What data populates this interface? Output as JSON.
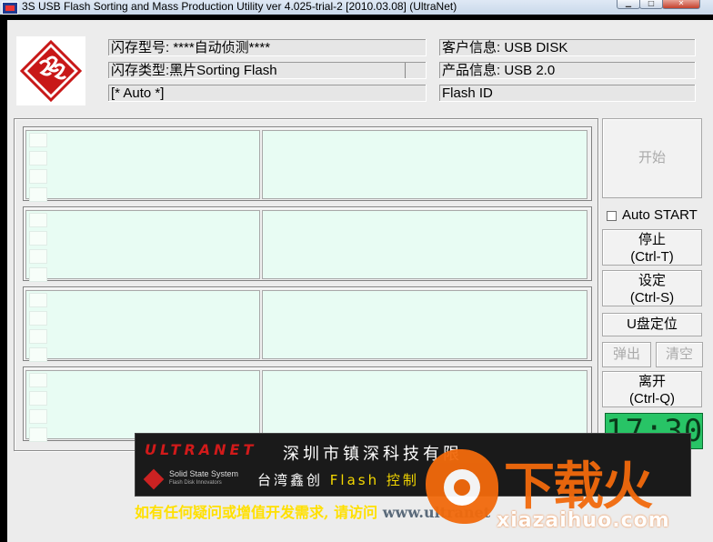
{
  "window": {
    "title": "3S USB Flash Sorting and Mass Production Utility ver 4.025-trial-2 [2010.03.08] (UltraNet)"
  },
  "info": {
    "flash_model": "闪存型号: ****自动侦测****",
    "flash_type": "闪存类型:黑片Sorting Flash",
    "auto_mode": "[* Auto *]",
    "customer_info": "客户信息: USB DISK",
    "product_info": "产品信息: USB 2.0",
    "flash_id": "Flash ID"
  },
  "buttons": {
    "start": "开始",
    "auto_start": "Auto START",
    "stop_line1": "停止",
    "stop_line2": "(Ctrl-T)",
    "settings_line1": "设定",
    "settings_line2": "(Ctrl-S)",
    "udisk_locate": "U盘定位",
    "eject": "弹出",
    "clear": "清空",
    "exit_line1": "离开",
    "exit_line2": "(Ctrl-Q)"
  },
  "clock": "17:30",
  "banner": {
    "brand": "ULTRANET",
    "line1": "深圳市镇深科技有限",
    "sss_name": "Solid State System",
    "sss_tagline": "Flash Disk Innovators",
    "line2_prefix": "台湾鑫创",
    "line2_highlight": "Flash 控制",
    "footer_text": "如有任何疑问或增值开发需求, 请访问 ",
    "footer_url": "www.ultranet"
  },
  "watermark": {
    "chars": "下载火",
    "site": "xiazaihuo.com"
  }
}
